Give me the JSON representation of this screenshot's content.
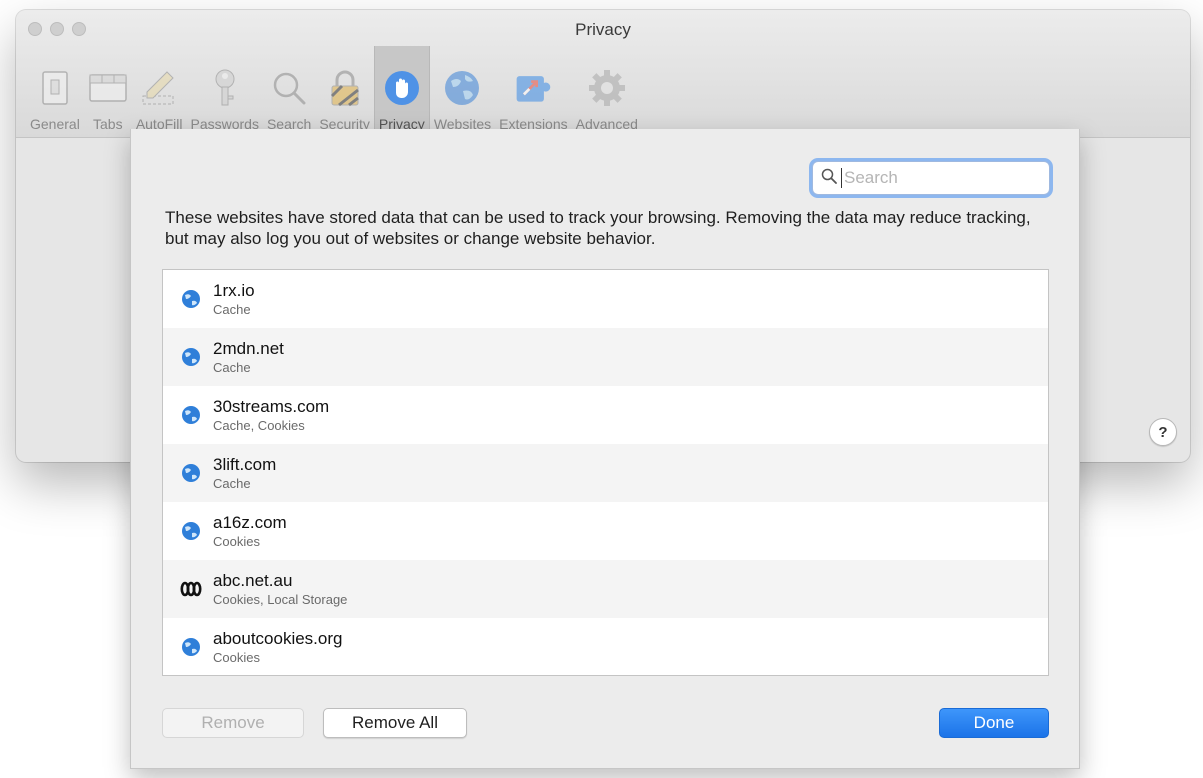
{
  "window": {
    "title": "Privacy"
  },
  "toolbar": {
    "items": [
      {
        "label": "General",
        "icon": "general-switch-icon"
      },
      {
        "label": "Tabs",
        "icon": "tabs-icon"
      },
      {
        "label": "AutoFill",
        "icon": "pencil-icon"
      },
      {
        "label": "Passwords",
        "icon": "key-icon"
      },
      {
        "label": "Search",
        "icon": "magnifier-icon"
      },
      {
        "label": "Security",
        "icon": "padlock-icon"
      },
      {
        "label": "Privacy",
        "icon": "hand-icon",
        "active": true
      },
      {
        "label": "Websites",
        "icon": "globe-icon"
      },
      {
        "label": "Extensions",
        "icon": "puzzle-icon"
      },
      {
        "label": "Advanced",
        "icon": "gear-icon"
      }
    ]
  },
  "help": {
    "label": "?"
  },
  "sheet": {
    "search_placeholder": "Search",
    "description": "These websites have stored data that can be used to track your browsing. Removing the data may reduce tracking, but may also log you out of websites or change website behavior.",
    "websites": [
      {
        "name": "1rx.io",
        "data": "Cache",
        "icon": "globe-icon"
      },
      {
        "name": "2mdn.net",
        "data": "Cache",
        "icon": "globe-icon"
      },
      {
        "name": "30streams.com",
        "data": "Cache, Cookies",
        "icon": "globe-icon"
      },
      {
        "name": "3lift.com",
        "data": "Cache",
        "icon": "globe-icon"
      },
      {
        "name": "a16z.com",
        "data": "Cookies",
        "icon": "globe-icon"
      },
      {
        "name": "abc.net.au",
        "data": "Cookies, Local Storage",
        "icon": "abc-logo-icon"
      },
      {
        "name": "aboutcookies.org",
        "data": "Cookies",
        "icon": "globe-icon"
      }
    ],
    "buttons": {
      "remove": "Remove",
      "remove_all": "Remove All",
      "done": "Done"
    }
  },
  "colors": {
    "accent": "#1b73e8",
    "focus_ring": "#8db7ef",
    "globe": "#2f7fd9"
  }
}
